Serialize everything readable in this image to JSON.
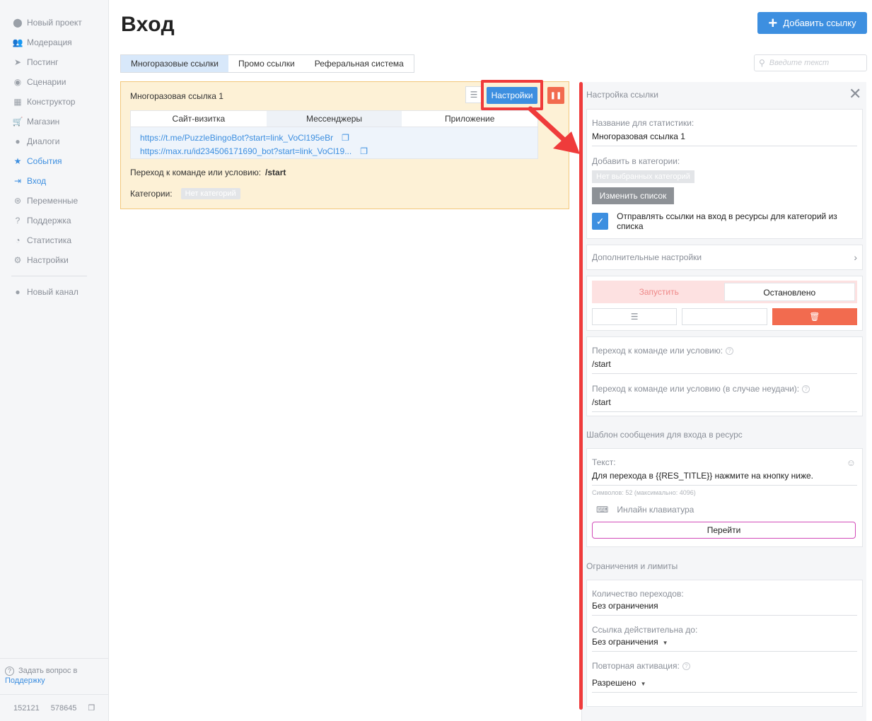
{
  "sidebar": {
    "items": [
      {
        "label": "Новый проект",
        "icon": "project-icon",
        "glyph": "⬤"
      },
      {
        "label": "Модерация",
        "icon": "users-icon",
        "glyph": "👥"
      },
      {
        "label": "Постинг",
        "icon": "paper-plane-icon",
        "glyph": "➤"
      },
      {
        "label": "Сценарии",
        "icon": "scenarios-icon",
        "glyph": "◉"
      },
      {
        "label": "Конструктор",
        "icon": "grid-icon",
        "glyph": "▦"
      },
      {
        "label": "Магазин",
        "icon": "cart-icon",
        "glyph": "🛒"
      },
      {
        "label": "Диалоги",
        "icon": "chat-icon",
        "glyph": "●"
      },
      {
        "label": "События",
        "icon": "star-icon",
        "glyph": "★"
      },
      {
        "label": "Вход",
        "icon": "sign-in-icon",
        "glyph": "⇥"
      },
      {
        "label": "Переменные",
        "icon": "variables-icon",
        "glyph": "⊛"
      },
      {
        "label": "Поддержка",
        "icon": "question-icon",
        "glyph": "?"
      },
      {
        "label": "Статистика",
        "icon": "pie-chart-icon",
        "glyph": "◔"
      },
      {
        "label": "Настройки",
        "icon": "gear-icon",
        "glyph": "⚙"
      }
    ],
    "channel": {
      "label": "Новый канал",
      "icon": "channel-icon",
      "glyph": "●"
    },
    "help_text": "Задать вопрос в",
    "help_link": "Поддержку",
    "counter_1": "152121",
    "counter_2": "578645"
  },
  "header": {
    "title": "Вход",
    "add_button": "Добавить ссылку",
    "search_placeholder": "Введите текст"
  },
  "tabs": [
    "Многоразовые ссылки",
    "Промо ссылки",
    "Реферальная система"
  ],
  "card": {
    "title": "Многоразовая ссылка 1",
    "settings_button": "Настройки",
    "inner_tabs": [
      "Сайт-визитка",
      "Мессенджеры",
      "Приложение"
    ],
    "links": [
      "https://t.me/PuzzleBingoBot?start=link_VoCl195eBr",
      "https://max.ru/id234506171690_bot?start=link_VoCl19..."
    ],
    "command_label": "Переход к команде или условию:",
    "command_value": "/start",
    "categories_label": "Категории:",
    "categories_value": "Нет категорий"
  },
  "panel": {
    "title": "Настройка ссылки",
    "name_label": "Название для статистики:",
    "name_value": "Многоразовая ссылка 1",
    "categories_label": "Добавить в категории:",
    "categories_badge": "Нет выбранных категорий",
    "change_list": "Изменить список",
    "checkbox_label": "Отправлять ссылки на вход в ресурсы для категорий из списка",
    "advanced": "Дополнительные настройки",
    "run": "Запустить",
    "stopped": "Остановлено",
    "cmd_label": "Переход к команде или условию:",
    "cmd_value": "/start",
    "fail_label": "Переход к команде или условию (в случае неудачи):",
    "fail_value": "/start",
    "template_title": "Шаблон сообщения для входа в ресурс",
    "text_label": "Текст:",
    "text_value": "Для перехода в {{RES_TITLE}} нажмите на кнопку ниже.",
    "char_count": "Символов: 52 (максимально: 4096)",
    "inline_keyboard": "Инлайн клавиатура",
    "go_button": "Перейти",
    "limits_title": "Ограничения и лимиты",
    "transitions_label": "Количество переходов:",
    "transitions_value": "Без ограничения",
    "valid_label": "Ссылка действительна до:",
    "valid_value": "Без ограничения",
    "reactivation_label": "Повторная активация:",
    "reactivation_value": "Разрешено"
  },
  "colors": {
    "accent": "#3d8fe0",
    "danger": "#f26b4f",
    "highlight_red": "#ef3b3b",
    "card_bg": "#fdf1d6"
  }
}
